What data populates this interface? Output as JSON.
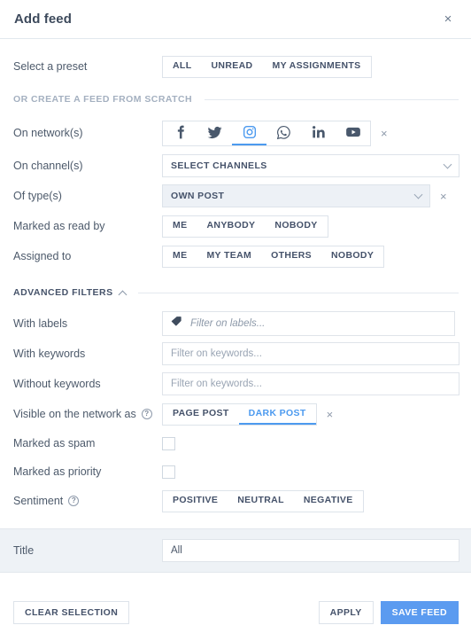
{
  "header": {
    "title": "Add feed",
    "close_label": "×"
  },
  "preset": {
    "label": "Select a preset",
    "options": [
      "ALL",
      "UNREAD",
      "MY ASSIGNMENTS"
    ],
    "selected": null
  },
  "scratch_divider": {
    "text": "OR CREATE A FEED FROM SCRATCH"
  },
  "networks": {
    "label": "On network(s)",
    "items": [
      {
        "name": "facebook",
        "icon": "facebook-icon",
        "active": false
      },
      {
        "name": "twitter",
        "icon": "twitter-icon",
        "active": false
      },
      {
        "name": "instagram",
        "icon": "instagram-icon",
        "active": true
      },
      {
        "name": "whatsapp",
        "icon": "whatsapp-icon",
        "active": false
      },
      {
        "name": "linkedin",
        "icon": "linkedin-icon",
        "active": false
      },
      {
        "name": "youtube",
        "icon": "youtube-icon",
        "active": false
      }
    ],
    "clear_label": "×"
  },
  "channels": {
    "label": "On channel(s)",
    "value": "SELECT CHANNELS"
  },
  "types": {
    "label": "Of type(s)",
    "value": "OWN POST",
    "clear_label": "×"
  },
  "read_by": {
    "label": "Marked as read by",
    "options": [
      "ME",
      "ANYBODY",
      "NOBODY"
    ],
    "selected": null
  },
  "assigned_to": {
    "label": "Assigned to",
    "options": [
      "ME",
      "MY TEAM",
      "OTHERS",
      "NOBODY"
    ],
    "selected": null
  },
  "advanced": {
    "divider_text": "ADVANCED FILTERS"
  },
  "labels_filter": {
    "label": "With labels",
    "placeholder": "Filter on labels...",
    "value": ""
  },
  "with_keywords": {
    "label": "With keywords",
    "placeholder": "Filter on keywords...",
    "value": ""
  },
  "without_keywords": {
    "label": "Without keywords",
    "placeholder": "Filter on keywords...",
    "value": ""
  },
  "visibility": {
    "label": "Visible on the network as",
    "help": "?",
    "options": [
      "PAGE POST",
      "DARK POST"
    ],
    "selected": "DARK POST",
    "clear_label": "×"
  },
  "spam": {
    "label": "Marked as spam",
    "checked": false
  },
  "priority": {
    "label": "Marked as priority",
    "checked": false
  },
  "sentiment": {
    "label": "Sentiment",
    "help": "?",
    "options": [
      "POSITIVE",
      "NEUTRAL",
      "NEGATIVE"
    ],
    "selected": null
  },
  "title_field": {
    "label": "Title",
    "value": "All",
    "placeholder": ""
  },
  "footer": {
    "clear_selection": "CLEAR SELECTION",
    "apply": "APPLY",
    "save_feed": "SAVE FEED"
  },
  "colors": {
    "accent": "#4c9aef",
    "primary_button": "#5b9bf0",
    "text": "#45526a",
    "muted": "#a4b0c0",
    "border": "#dde3ea",
    "filled_bg": "#edf1f6",
    "strip_bg": "#eef2f6"
  }
}
